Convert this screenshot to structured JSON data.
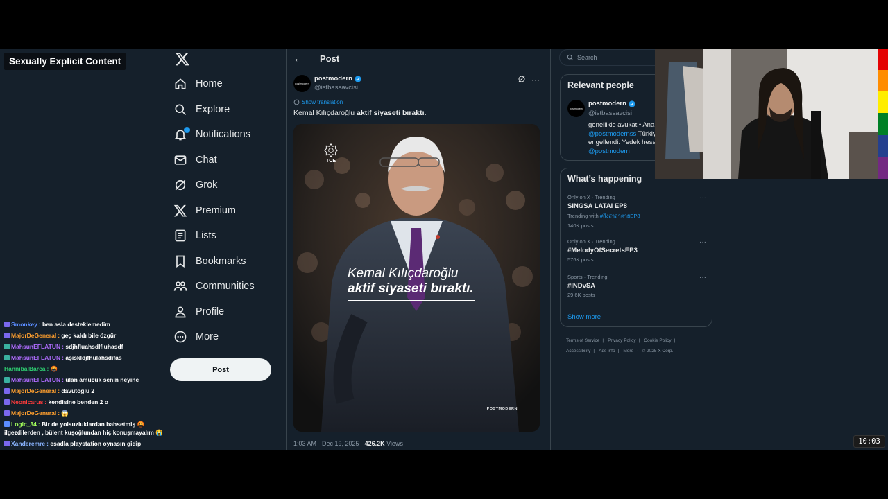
{
  "overlay": {
    "content_badge": "Sexually Explicit Content",
    "clock": "10:03"
  },
  "chat": [
    {
      "user": "Smonkey",
      "color": "#5b8cff",
      "badge": "#7b68ee",
      "msg": "ben asla desteklemedim"
    },
    {
      "user": "MajorDeGeneral",
      "color": "#ff9f2e",
      "badge": "#7b68ee",
      "msg": "geç kaldı bile özgür"
    },
    {
      "user": "MahsunEFLATUN",
      "color": "#b06cff",
      "badge": "#3ab0a0",
      "msg": "sdjhfluahsdlfiuhasdf"
    },
    {
      "user": "MahsunEFLATUN",
      "color": "#b06cff",
      "badge": "#3ab0a0",
      "msg": "aşiskldjfhulahsdıfas"
    },
    {
      "user": "HannibalBarca",
      "color": "#2ecc71",
      "badge": "",
      "msg": "🤬"
    },
    {
      "user": "MahsunEFLATUN",
      "color": "#b06cff",
      "badge": "#3ab0a0",
      "msg": "ulan amucuk senin neyine"
    },
    {
      "user": "MajorDeGeneral",
      "color": "#ff9f2e",
      "badge": "#7b68ee",
      "msg": "davutoğlu 2"
    },
    {
      "user": "Neonicarus",
      "color": "#ff3b3b",
      "badge": "#7b68ee",
      "msg": "kendisine benden 2 o"
    },
    {
      "user": "MajorDeGeneral",
      "color": "#ff9f2e",
      "badge": "#7b68ee",
      "msg": "😱"
    },
    {
      "user": "Logic_34",
      "color": "#a3ff5b",
      "badge": "#5b8cff",
      "msg": "Bir de yolsuzluklardan bahsetmiş 🤬 ilgezdilerden , bülent kuşoğlundan hiç konuşmayalım 😭",
      "wrap": true
    },
    {
      "user": "Xanderemre",
      "color": "#8ab4ff",
      "badge": "#7b68ee",
      "msg": "esadla playstation oynasın gidip"
    }
  ],
  "nav": {
    "items": [
      {
        "label": "Home",
        "icon": "home-icon"
      },
      {
        "label": "Explore",
        "icon": "search-icon"
      },
      {
        "label": "Notifications",
        "icon": "bell-icon"
      },
      {
        "label": "Chat",
        "icon": "mail-icon"
      },
      {
        "label": "Grok",
        "icon": "grok-icon"
      },
      {
        "label": "Premium",
        "icon": "x-icon"
      },
      {
        "label": "Lists",
        "icon": "list-icon"
      },
      {
        "label": "Bookmarks",
        "icon": "bookmark-icon"
      },
      {
        "label": "Communities",
        "icon": "communities-icon"
      },
      {
        "label": "Profile",
        "icon": "person-icon"
      },
      {
        "label": "More",
        "icon": "more-icon"
      }
    ],
    "notifications_count": "1",
    "post_button": "Post"
  },
  "post": {
    "header": "Post",
    "author_name": "postmodern",
    "author_handle": "@istbassavcisi",
    "avatar_text": "postmodern",
    "show_translation": "Show translation",
    "text_plain": "Kemal Kılıçdaroğlu ",
    "text_bold": "aktif siyaseti bıraktı.",
    "image_line1": "Kemal Kılıçdaroğlu",
    "image_line2": "aktif siyaseti bıraktı.",
    "image_logo": "TCE",
    "image_watermark": "POSTMODERN",
    "timestamp": "1:03 AM · Dec 19, 2025 · ",
    "views_count": "426.2K",
    "views_label": " Views"
  },
  "sidebar": {
    "search_placeholder": "Search",
    "relevant_title": "Relevant people",
    "relevant_name": "postmodern",
    "relevant_handle": "@istbassavcisi",
    "relevant_bio_1": "genellikle avukat • Ana",
    "relevant_bio_link_1": "@postmodernss",
    "relevant_bio_2": " Türkiy",
    "relevant_bio_3": "engellendi. Yedek hesa",
    "relevant_bio_link_2": "@postmodern",
    "happening_title": "What’s happening",
    "trends": [
      {
        "context": "Only on X · Trending",
        "topic": "SINGSA LATAI EP8",
        "sub_prefix": "Trending with ",
        "sub_link": "#สิงสาลาตายEP8",
        "posts": "140K posts"
      },
      {
        "context": "Only on X · Trending",
        "topic": "#MelodyOfSecretsEP3",
        "posts": "576K posts"
      },
      {
        "context": "Sports · Trending",
        "topic": "#INDvSA",
        "posts": "29.6K posts"
      }
    ],
    "show_more": "Show more",
    "footer": [
      "Terms of Service",
      "Privacy Policy",
      "Cookie Policy",
      "Accessibility",
      "Ads info",
      "More ···",
      "© 2025 X Corp."
    ]
  }
}
